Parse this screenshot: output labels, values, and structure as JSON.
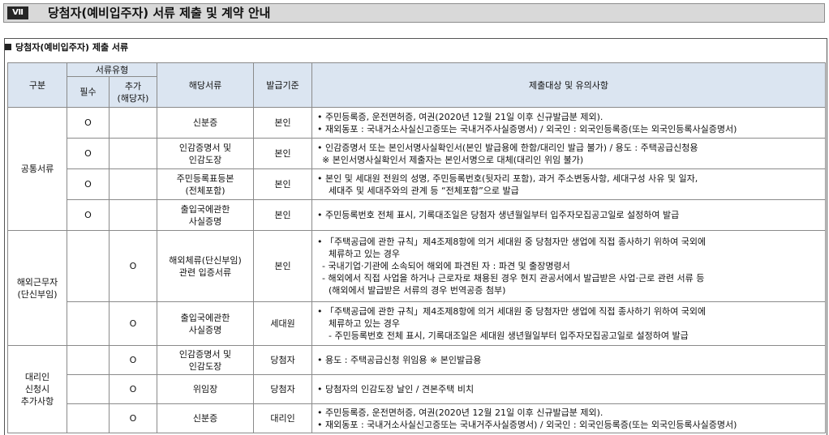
{
  "header": {
    "roman": "Ⅶ",
    "title": "당첨자(예비입주자) 서류 제출 및 계약 안내"
  },
  "section": {
    "title": "당첨자(예비입주자) 제출 서류"
  },
  "table": {
    "head": {
      "category": "구분",
      "doc_type": "서류유형",
      "required": "필수",
      "additional": "추가\n(해당자)",
      "document": "해당서류",
      "issuer": "발급기준",
      "notes": "제출대상 및 유의사항"
    },
    "groups": {
      "common": "공통서류",
      "overseas": "해외근무자\n(단신부임)",
      "proxy": "대리인\n신청시\n추가사항"
    },
    "rows": [
      {
        "req": "O",
        "add": "",
        "doc": "신분증",
        "issuer": "본인",
        "notes": [
          "• 주민등록증, 운전면허증, 여권(2020년 12월 21일 이후 신규발급분 제외).",
          "• 재외동포 : 국내거소사실신고증또는 국내거주사실증명서) / 외국인 : 외국인등록증(또는 외국인등록사실증명서)"
        ]
      },
      {
        "req": "O",
        "add": "",
        "doc": "인감증명서 및\n인감도장",
        "issuer": "본인",
        "notes": [
          "• 인감증명서 또는 본인서명사실확인서(본인 발급용에 한함/대리인 발급 불가) / 용도 : 주택공급신청용",
          "※ 본인서명사실확인서 제출자는 본인서명으로 대체(대리인 위임 불가)"
        ]
      },
      {
        "req": "O",
        "add": "",
        "doc": "주민등록표등본\n(전체포함)",
        "issuer": "본인",
        "notes": [
          "• 본인 및 세대원 전원의 성명, 주민등록번호(뒷자리 포함), 과거 주소변동사항, 세대구성 사유 및 일자,",
          "세대주 및 세대주와의 관계 등 “전체포함”으로 발급"
        ]
      },
      {
        "req": "O",
        "add": "",
        "doc": "출입국에관한\n사실증명",
        "issuer": "본인",
        "notes": [
          "• 주민등록번호 전체 표시, 기록대조일은 당첨자 생년월일부터 입주자모집공고일로 설정하여 발급"
        ]
      },
      {
        "req": "",
        "add": "O",
        "doc": "해외체류(단신부임)\n관련 입증서류",
        "issuer": "본인",
        "notes": [
          "• 「주택공급에 관한 규칙」제4조제8항에 의거 세대원 중 당첨자만 생업에 직접 종사하기 위하여 국외에",
          "체류하고 있는 경우",
          "- 국내기업·기관에 소속되어 해외에 파견된 자 : 파견 및 출장명령서",
          "- 해외에서 직접 사업을 하거나 근로자로 채용된 경우 현지 관공서에서 발급받은 사업·근로 관련 서류 등",
          "(해외에서 발급받은 서류의 경우 번역공증 첨부)"
        ]
      },
      {
        "req": "",
        "add": "O",
        "doc": "출입국에관한\n사실증명",
        "issuer": "세대원",
        "notes": [
          "• 「주택공급에 관한 규칙」제4조제8항에 의거 세대원 중 당첨자만 생업에 직접 종사하기 위하여 국외에",
          "체류하고 있는 경우",
          "- 주민등록번호 전체 표시, 기록대조일은 세대원 생년월일부터 입주자모집공고일로 설정하여 발급"
        ]
      },
      {
        "req": "",
        "add": "O",
        "doc": "인감증명서 및\n인감도장",
        "issuer": "당첨자",
        "notes": [
          "• 용도 : 주택공급신청 위임용 ※ 본인발급용"
        ]
      },
      {
        "req": "",
        "add": "O",
        "doc": "위임장",
        "issuer": "당첨자",
        "notes": [
          "• 당첨자의 인감도장 날인 / 견본주택 비치"
        ]
      },
      {
        "req": "",
        "add": "O",
        "doc": "신분증",
        "issuer": "대리인",
        "notes": [
          "• 주민등록증, 운전면허증, 여권(2020년 12월 21일 이후 신규발급분 제외).",
          "• 재외동포 : 국내거소사실신고증또는 국내거주사실증명서) / 외국인 : 외국인등록증(또는 외국인등록사실증명서)"
        ]
      }
    ]
  }
}
